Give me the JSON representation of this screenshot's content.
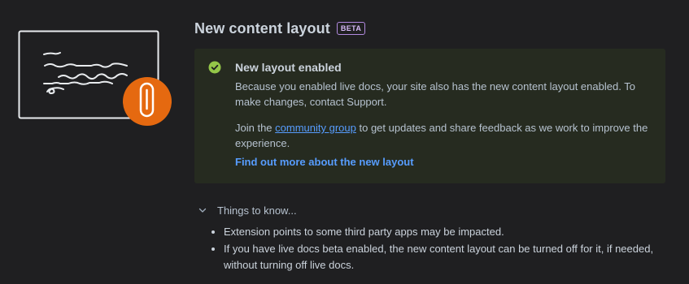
{
  "header": {
    "title": "New content layout",
    "badge": "BETA"
  },
  "panel": {
    "title": "New layout enabled",
    "text1": "Because you enabled live docs, your site also has the new content layout enabled. To make changes, contact Support.",
    "text2_before": "Join the ",
    "text2_link": "community group",
    "text2_after": " to get updates and share feedback as we work to improve the experience.",
    "cta_link": "Find out more about the new layout"
  },
  "things": {
    "toggle_label": "Things to know...",
    "items": [
      "Extension points to some third party apps may be impacted.",
      "If you have live docs beta enabled, the new content layout can be turned off for it, if needed, without turning off live docs."
    ]
  },
  "colors": {
    "background": "#1f1f21",
    "panel_background": "#262b20",
    "success_green": "#94c748",
    "link_blue": "#579dff",
    "accent_orange": "#e56910",
    "badge_purple": "#b28ae0"
  }
}
